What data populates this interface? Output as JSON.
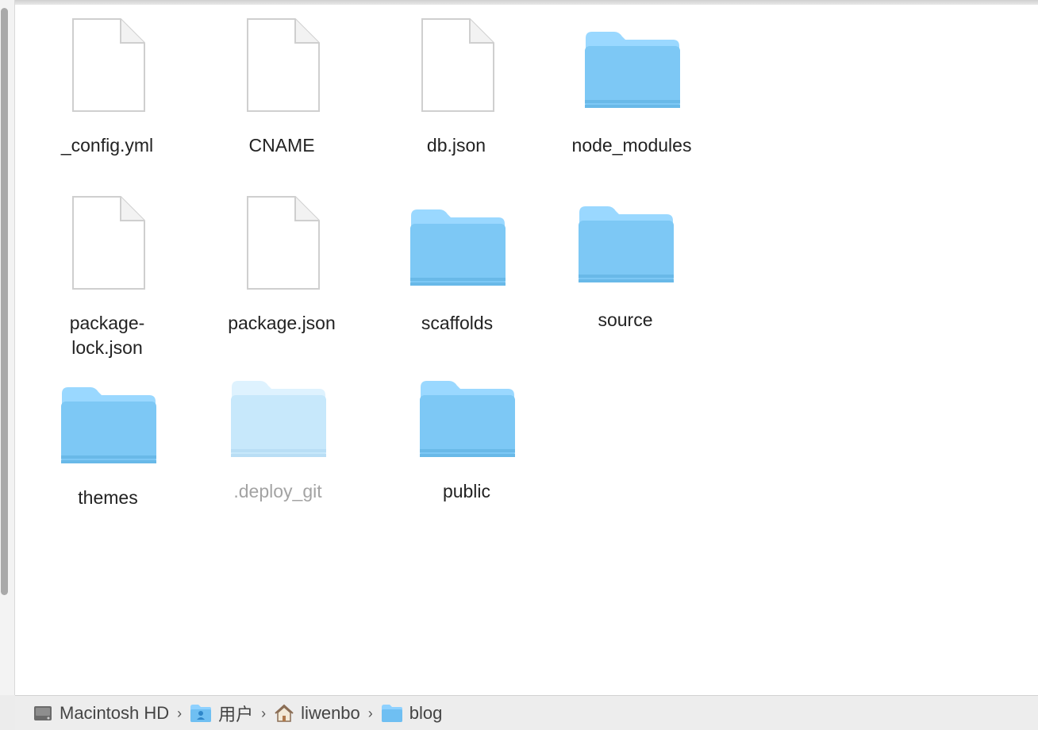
{
  "files": [
    {
      "name": "_config.yml",
      "type": "file",
      "icon": "document-icon",
      "dim": false
    },
    {
      "name": "CNAME",
      "type": "file",
      "icon": "document-icon",
      "dim": false
    },
    {
      "name": "db.json",
      "type": "file",
      "icon": "document-icon",
      "dim": false
    },
    {
      "name": "node_modules",
      "type": "folder",
      "icon": "folder-icon",
      "dim": false
    },
    {
      "name": "package-\nlock.json",
      "type": "file",
      "icon": "document-icon",
      "dim": false
    },
    {
      "name": "package.json",
      "type": "file",
      "icon": "document-icon",
      "dim": false
    },
    {
      "name": "scaffolds",
      "type": "folder",
      "icon": "folder-icon",
      "dim": false
    },
    {
      "name": "source",
      "type": "folder",
      "icon": "folder-icon",
      "dim": false
    },
    {
      "name": "themes",
      "type": "folder",
      "icon": "folder-icon",
      "dim": false
    },
    {
      "name": ".deploy_git",
      "type": "folder",
      "icon": "folder-icon",
      "dim": true
    },
    {
      "name": "public",
      "type": "folder",
      "icon": "folder-icon",
      "dim": false
    }
  ],
  "path_bar": [
    {
      "label": "Macintosh HD",
      "icon": "hard-drive-icon"
    },
    {
      "label": "用户",
      "icon": "users-folder-icon"
    },
    {
      "label": "liwenbo",
      "icon": "home-icon"
    },
    {
      "label": "blog",
      "icon": "folder-icon"
    }
  ],
  "colors": {
    "folder_front": "#7dc8f5",
    "folder_back": "#9ad8ff",
    "folder_dim_front": "#c7e8fb",
    "document_fill": "#ffffff",
    "document_stroke": "#c9c9c9"
  }
}
